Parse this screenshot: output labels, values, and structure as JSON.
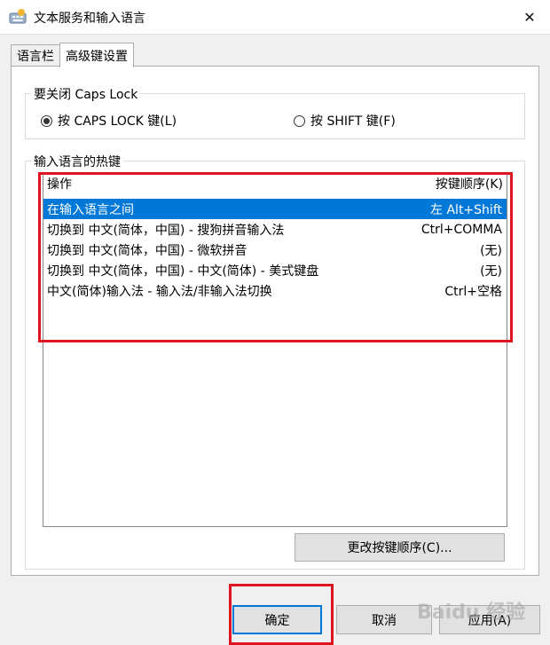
{
  "window": {
    "title": "文本服务和输入语言",
    "close_glyph": "✕"
  },
  "tabs": [
    {
      "label": "语言栏"
    },
    {
      "label": "高级键设置"
    }
  ],
  "caps_lock": {
    "group_label": "要关闭 Caps Lock",
    "option_caps": "按 CAPS LOCK 键(L)",
    "option_shift": "按 SHIFT 键(F)",
    "selected": "option_caps"
  },
  "hotkeys": {
    "group_label": "输入语言的热键",
    "columns": {
      "action": "操作",
      "key_sequence": "按键顺序(K)"
    },
    "rows": [
      {
        "action": "在输入语言之间",
        "keys": "左 Alt+Shift",
        "selected": true
      },
      {
        "action": "切换到 中文(简体，中国) - 搜狗拼音输入法",
        "keys": "Ctrl+COMMA",
        "selected": false
      },
      {
        "action": "切换到 中文(简体，中国) - 微软拼音",
        "keys": "(无)",
        "selected": false
      },
      {
        "action": "切换到 中文(简体，中国) - 中文(简体) - 美式键盘",
        "keys": "(无)",
        "selected": false
      },
      {
        "action": "中文(简体)输入法 - 输入法/非输入法切换",
        "keys": "Ctrl+空格",
        "selected": false
      }
    ],
    "change_button": "更改按键顺序(C)..."
  },
  "footer": {
    "ok": "确定",
    "cancel": "取消",
    "apply": "应用(A)"
  },
  "watermark": "Baidu 经验",
  "colors": {
    "selection": "#0078d7",
    "highlight_box": "#e0141e"
  }
}
